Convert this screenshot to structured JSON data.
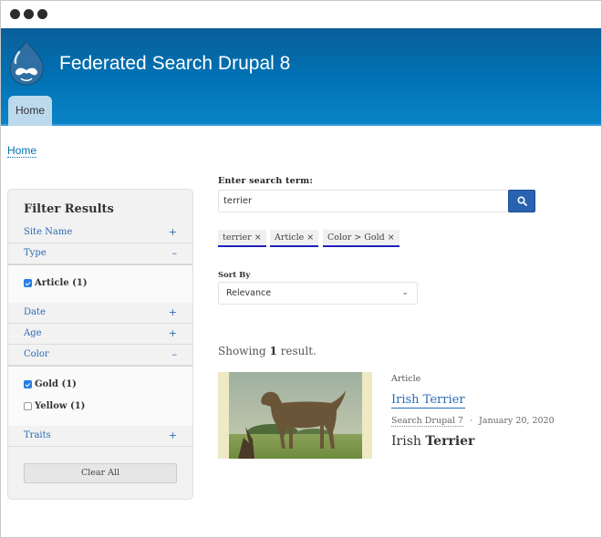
{
  "site": {
    "title": "Federated Search Drupal 8",
    "logo_icon": "drupal-drop-icon",
    "nav": [
      {
        "label": "Home",
        "active": true
      }
    ]
  },
  "breadcrumb": [
    {
      "label": "Home"
    }
  ],
  "sidebar": {
    "title": "Filter Results",
    "facets": {
      "site_name": {
        "label": "Site Name",
        "toggle": "+"
      },
      "type": {
        "label": "Type",
        "toggle": "–",
        "options": [
          {
            "label": "Article (1)",
            "checked": true
          }
        ]
      },
      "date": {
        "label": "Date",
        "toggle": "+"
      },
      "age": {
        "label": "Age",
        "toggle": "+"
      },
      "color": {
        "label": "Color",
        "toggle": "–",
        "options": [
          {
            "label": "Gold (1)",
            "checked": true
          },
          {
            "label": "Yellow (1)",
            "checked": false
          }
        ]
      },
      "traits": {
        "label": "Traits",
        "toggle": "+"
      }
    },
    "clear_all_label": "Clear All"
  },
  "search": {
    "label": "Enter search term:",
    "value": "terrier",
    "button_icon": "search-icon"
  },
  "active_filters": [
    {
      "label": "terrier ×"
    },
    {
      "label": "Article ×"
    },
    {
      "label": "Color > Gold ×"
    }
  ],
  "sort": {
    "label": "Sort By",
    "selected": "Relevance",
    "chevron": "⌄"
  },
  "results_summary": {
    "prefix": "Showing ",
    "count": "1",
    "suffix": " result."
  },
  "results": [
    {
      "type": "Article",
      "title": "Irish Terrier",
      "source": "Search Drupal 7",
      "separator": "·",
      "date": "January 20, 2020",
      "snippet_plain": "Irish ",
      "snippet_bold": "Terrier",
      "image_alt": "Painting of an Irish Terrier dog standing in a grassy field"
    }
  ],
  "colors": {
    "header_top": "#0a5f99",
    "header_bottom": "#0a84c6",
    "link": "#2a6bb5",
    "search_button": "#2962b0",
    "chip_underline": "#2020c0"
  }
}
